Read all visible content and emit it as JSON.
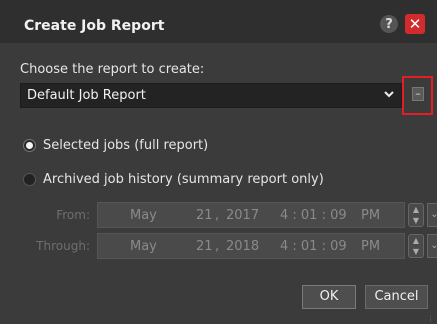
{
  "dialog": {
    "title": "Create Job Report",
    "help_icon": "?",
    "close_icon": "✕"
  },
  "report": {
    "prompt": "Choose the report to create:",
    "selected": "Default Job Report",
    "chevron_icon": "chevron-down-icon",
    "remove_label": "–"
  },
  "options": {
    "selected_jobs": "Selected jobs (full report)",
    "archived_history": "Archived job history (summary report only)"
  },
  "from": {
    "label": "From:",
    "month": "May",
    "day": "21",
    "year": "2017",
    "time": "4 : 01 : 09",
    "ampm": "PM"
  },
  "through": {
    "label": "Through:",
    "month": "May",
    "day": "21",
    "year": "2018",
    "time": "4 : 01 : 09",
    "ampm": "PM"
  },
  "buttons": {
    "ok": "OK",
    "cancel": "Cancel"
  },
  "colors": {
    "highlight": "#e41e26",
    "close": "#d32b2b",
    "dialog_bg": "#3b3b3b"
  }
}
